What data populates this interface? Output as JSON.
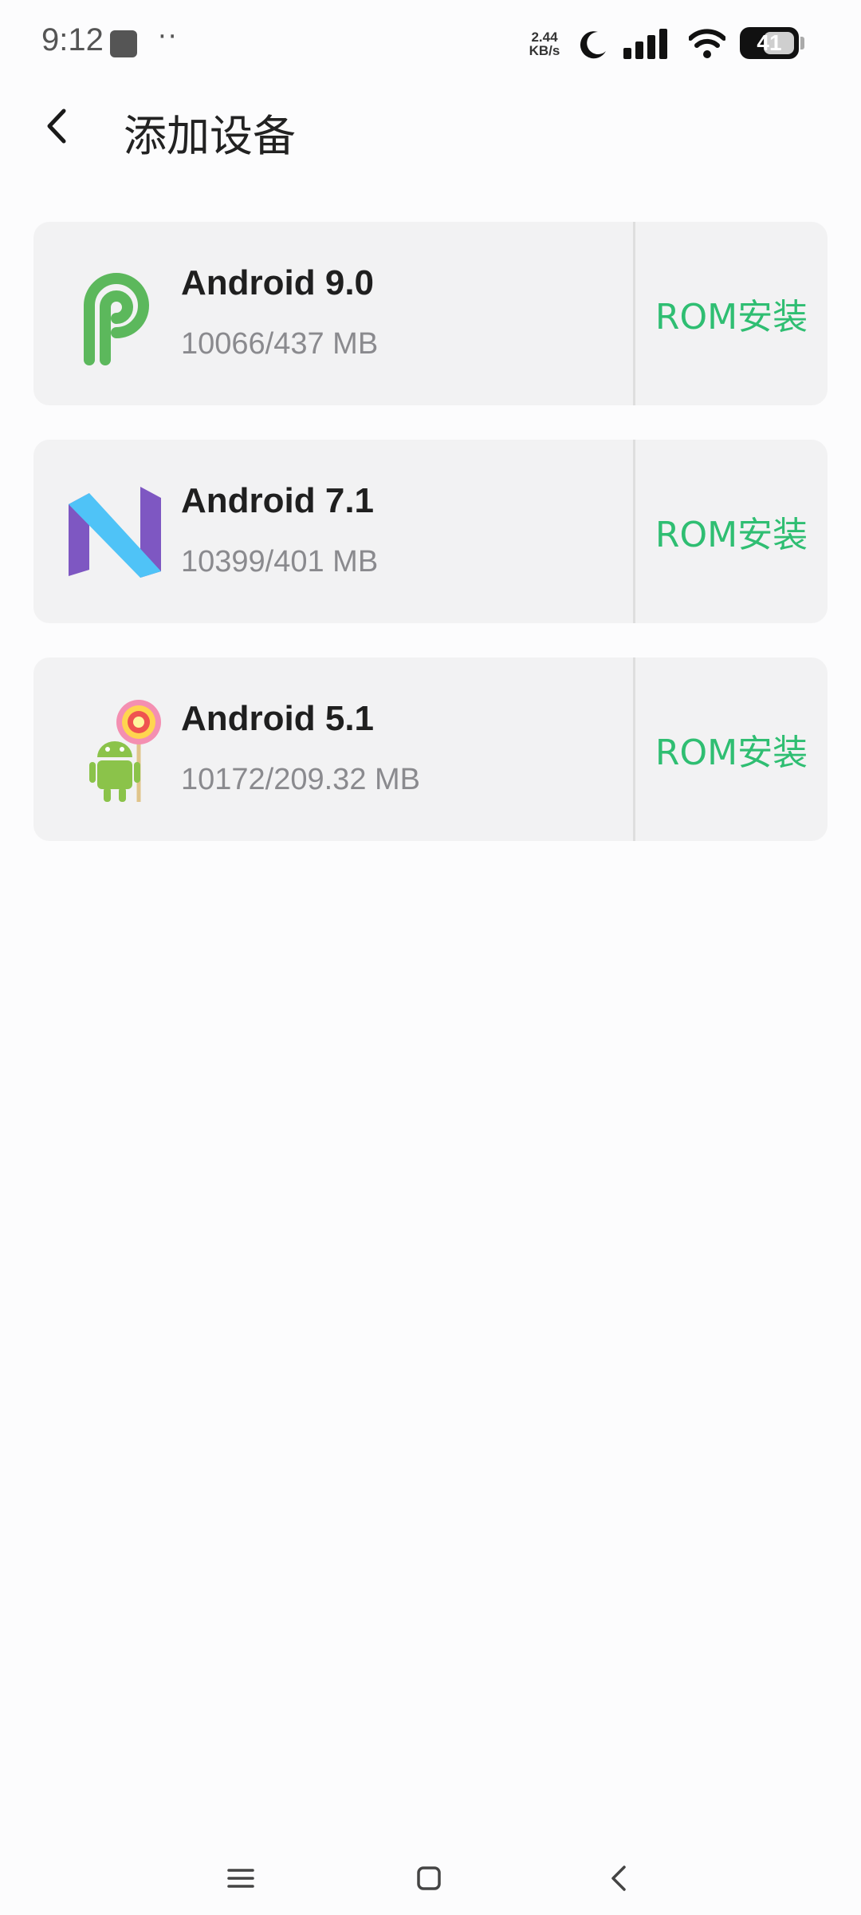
{
  "status_bar": {
    "time": "9:12",
    "dots": "··",
    "net_speed_value": "2.44",
    "net_speed_unit": "KB/s",
    "battery": "41",
    "icons": [
      "moon-icon",
      "signal-icon",
      "wifi-icon",
      "battery-icon"
    ]
  },
  "header": {
    "title": "添加设备",
    "back_icon": "chevron-left-icon"
  },
  "devices": [
    {
      "name": "Android 9.0",
      "meta": "10066/437 MB",
      "action": "ROM安装",
      "icon": "android-pie-logo"
    },
    {
      "name": "Android 7.1",
      "meta": "10399/401 MB",
      "action": "ROM安装",
      "icon": "android-nougat-logo"
    },
    {
      "name": "Android 5.1",
      "meta": "10172/209.32 MB",
      "action": "ROM安装",
      "icon": "android-lollipop-logo"
    }
  ],
  "colors": {
    "accent": "#2fbe72",
    "card_bg": "#f2f2f3",
    "meta_text": "#8a8a8e"
  },
  "nav_bar": {
    "icons": [
      "menu-icon",
      "home-icon",
      "back-icon"
    ]
  }
}
